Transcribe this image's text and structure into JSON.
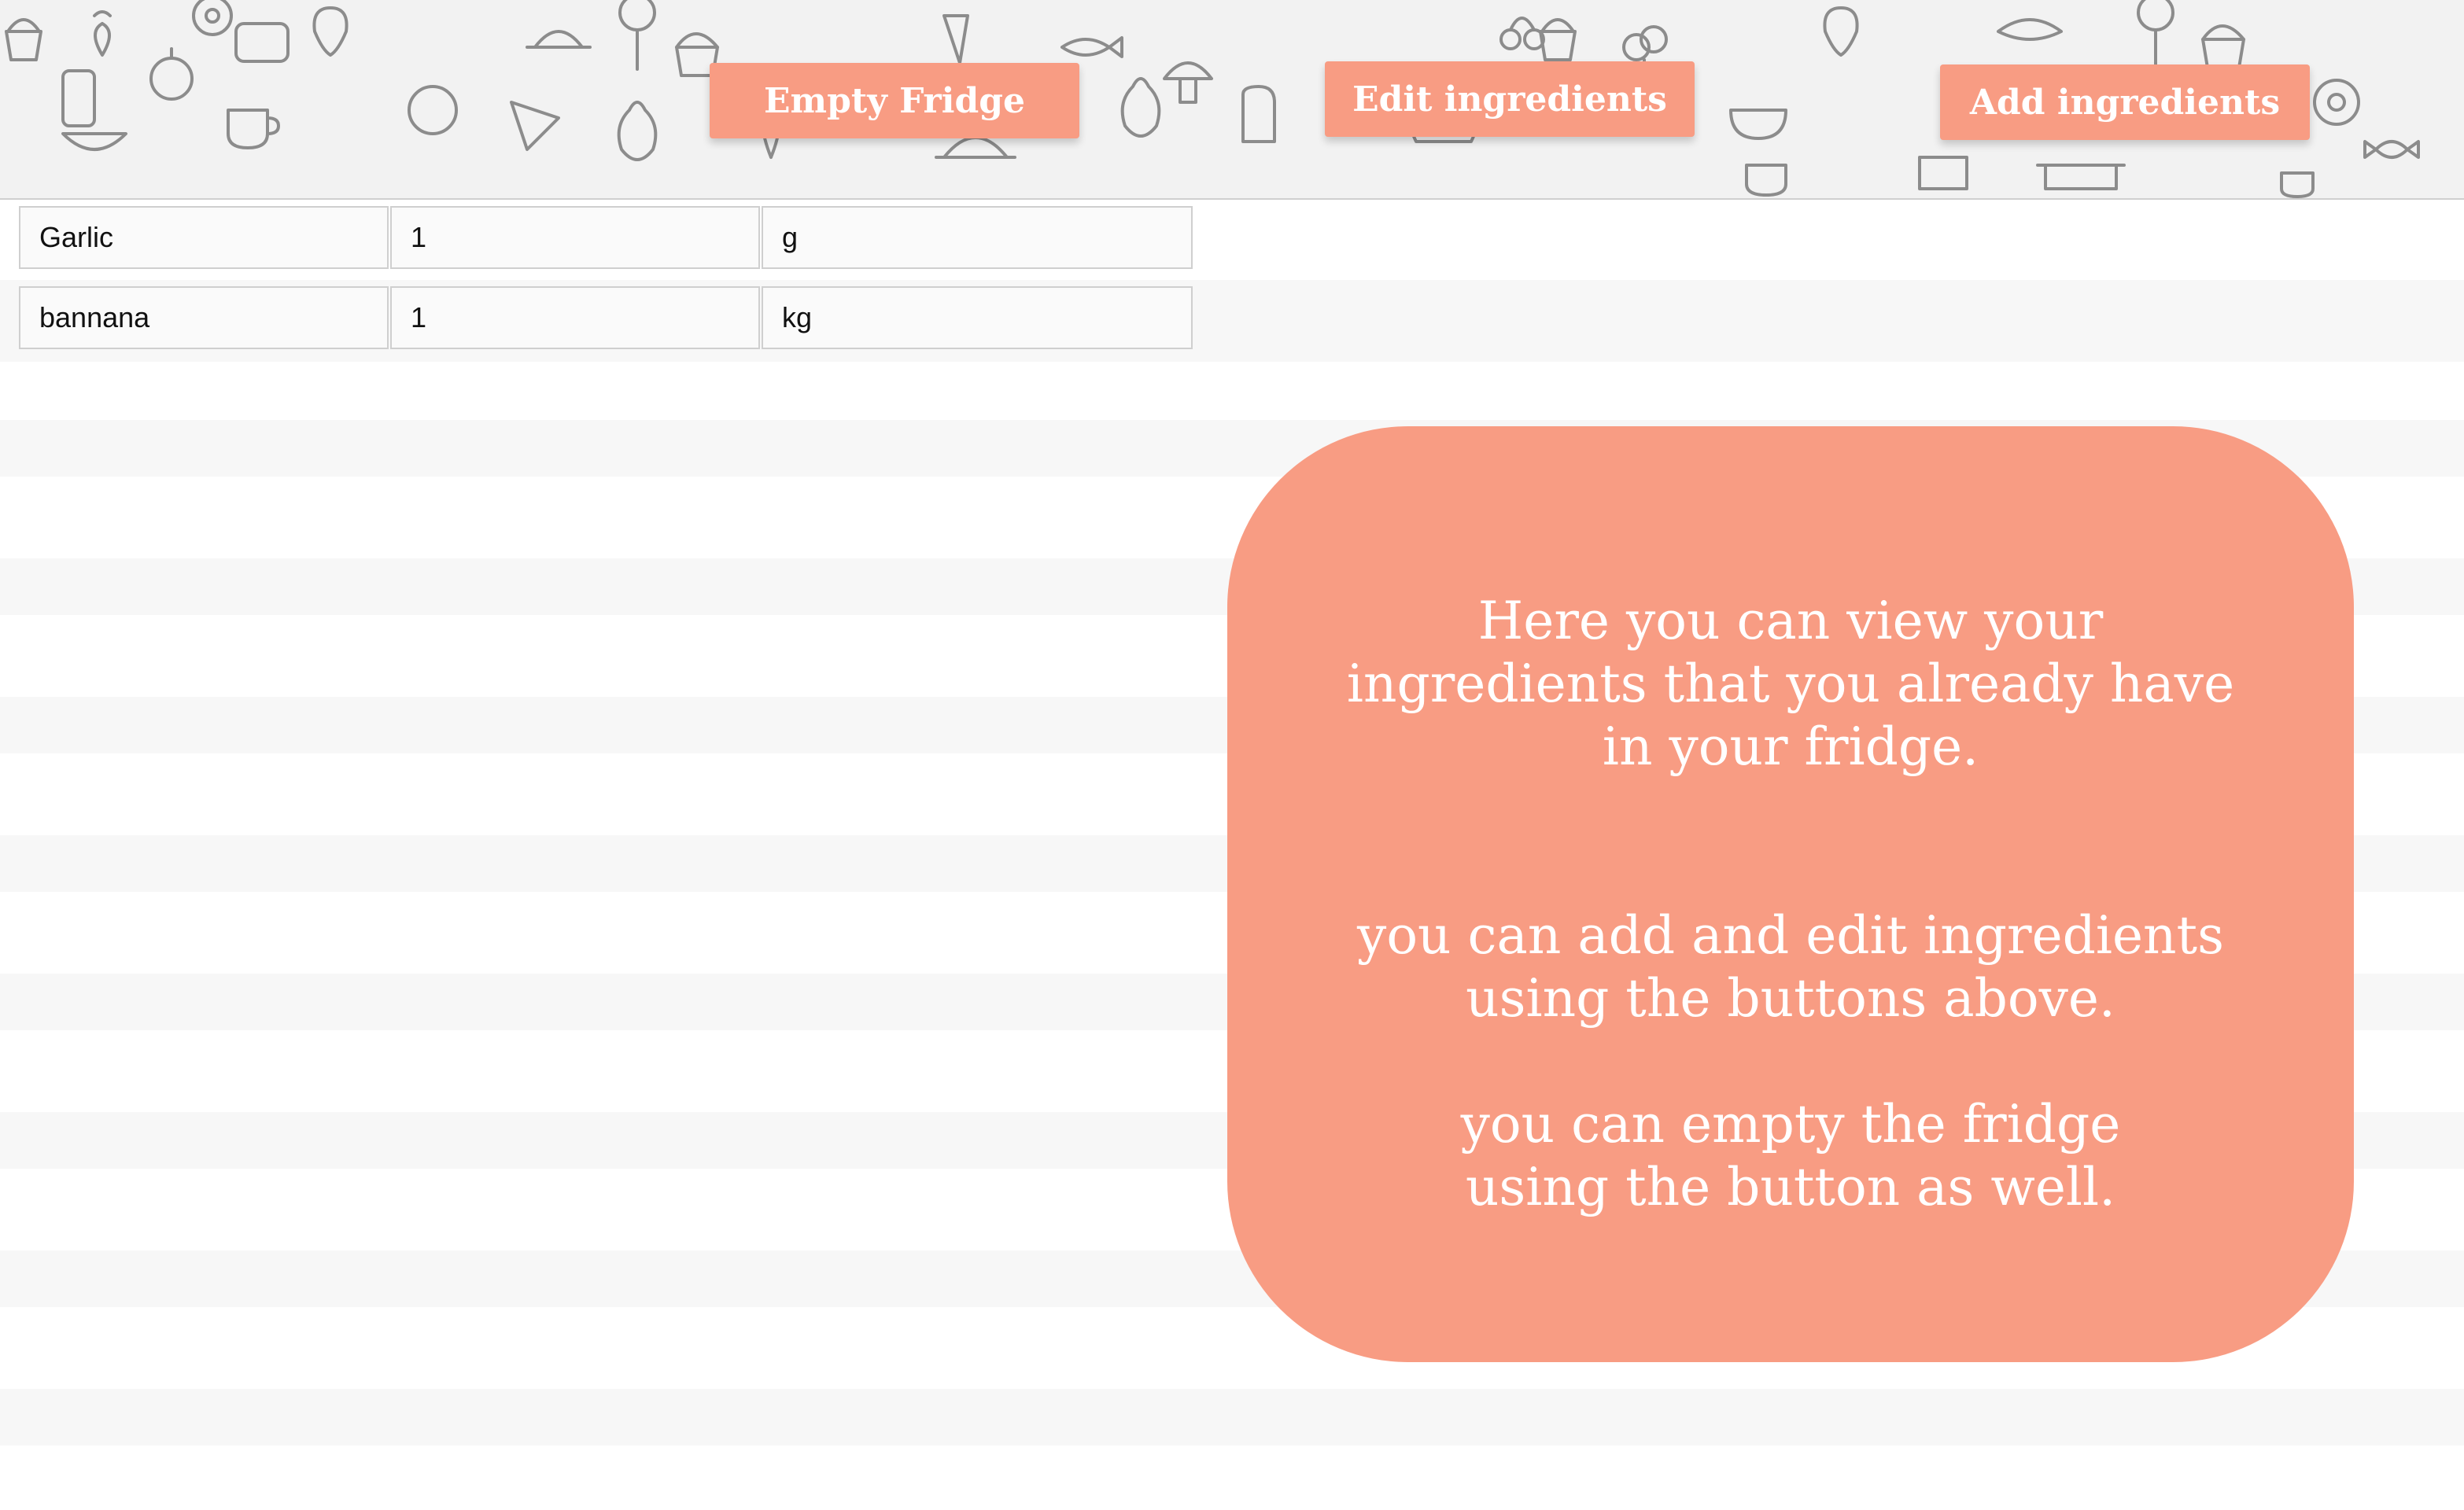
{
  "header": {
    "buttons": {
      "empty_fridge": "Empty Fridge",
      "edit_ingredients": "Edit ingredients",
      "add_ingredients": "Add ingredients"
    }
  },
  "ingredients": [
    {
      "name": "Garlic",
      "quantity": "1",
      "unit": "g"
    },
    {
      "name": "bannana",
      "quantity": "1",
      "unit": "kg"
    }
  ],
  "info": {
    "line1": "Here you can view your\ningredients that you already have\nin your fridge.",
    "line2": "you can add and edit ingredients\nusing the buttons above.",
    "line3": "you can empty the fridge\nusing the button as well."
  },
  "colors": {
    "accent": "#f89c83",
    "header_bg": "#f2f2f2",
    "stripe": "#f7f7f7",
    "doodle_stroke": "#8c8c8c"
  }
}
